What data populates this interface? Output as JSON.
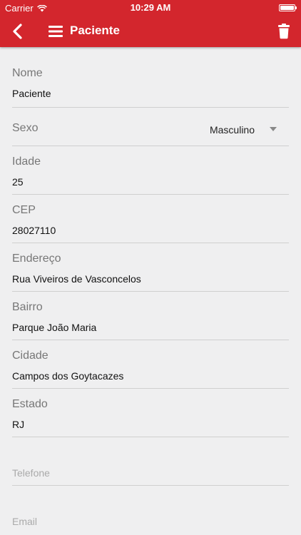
{
  "status_bar": {
    "carrier": "Carrier",
    "time": "10:29 AM"
  },
  "header": {
    "title": "Paciente",
    "icons": [
      "back-chevron-icon",
      "menu-icon",
      "trash-icon"
    ],
    "color": "#d3262d"
  },
  "form": {
    "nome": {
      "label": "Nome",
      "value": "Paciente"
    },
    "sexo": {
      "label": "Sexo",
      "value": "Masculino"
    },
    "idade": {
      "label": "Idade",
      "value": "25"
    },
    "cep": {
      "label": "CEP",
      "value": "28027110"
    },
    "endereco": {
      "label": "Endereço",
      "value": "Rua Viveiros de Vasconcelos"
    },
    "bairro": {
      "label": "Bairro",
      "value": "Parque João Maria"
    },
    "cidade": {
      "label": "Cidade",
      "value": "Campos dos Goytacazes"
    },
    "estado": {
      "label": "Estado",
      "value": "RJ"
    },
    "telefone": {
      "placeholder": "Telefone"
    },
    "email": {
      "placeholder": "Email"
    }
  }
}
